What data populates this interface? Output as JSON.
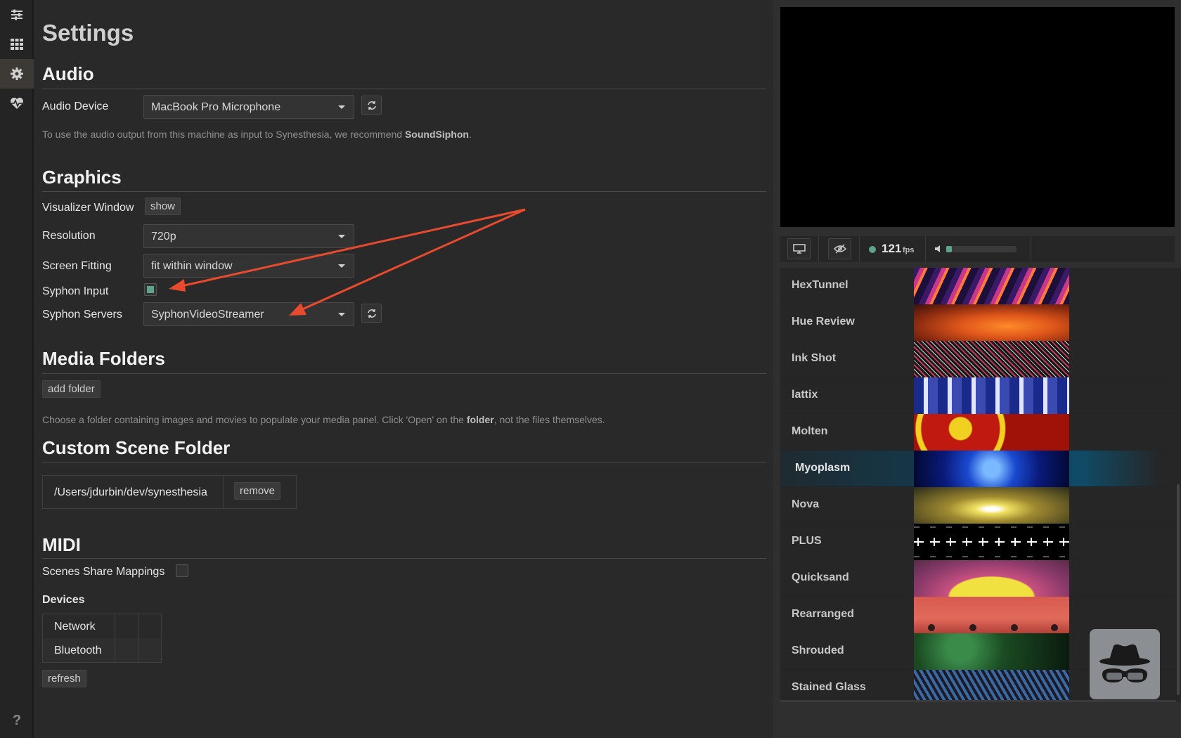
{
  "rail": {
    "items": [
      {
        "icon": "sliders-icon",
        "active": false
      },
      {
        "icon": "grid-icon",
        "active": false
      },
      {
        "icon": "gear-icon",
        "active": true
      },
      {
        "icon": "heart-pulse-icon",
        "active": false
      }
    ],
    "help_label": "?"
  },
  "settings": {
    "title": "Settings",
    "audio": {
      "title": "Audio",
      "device_label": "Audio Device",
      "device_value": "MacBook Pro Microphone",
      "help_prefix": "To use the audio output from this machine as input to Synesthesia, we recommend ",
      "help_bold": "SoundSiphon",
      "help_suffix": "."
    },
    "graphics": {
      "title": "Graphics",
      "visualizer_label": "Visualizer Window",
      "visualizer_button": "show",
      "resolution_label": "Resolution",
      "resolution_value": "720p",
      "fitting_label": "Screen Fitting",
      "fitting_value": "fit within window",
      "syphon_input_label": "Syphon Input",
      "syphon_input_checked": true,
      "syphon_servers_label": "Syphon Servers",
      "syphon_servers_value": "SyphonVideoStreamer"
    },
    "media": {
      "title": "Media Folders",
      "add_button": "add folder",
      "help_prefix": "Choose a folder containing images and movies to populate your media panel. Click 'Open' on the ",
      "help_bold": "folder",
      "help_suffix": ", not the files themselves."
    },
    "custom_scene": {
      "title": "Custom Scene Folder",
      "path": "/Users/jdurbin/dev/synesthesia",
      "remove_button": "remove"
    },
    "midi": {
      "title": "MIDI",
      "share_label": "Scenes Share Mappings",
      "share_checked": false,
      "devices_label": "Devices",
      "devices": [
        "Network",
        "Bluetooth"
      ],
      "refresh_button": "refresh"
    }
  },
  "preview_controls": {
    "fps_value": "121",
    "fps_unit": "fps",
    "volume_fraction": 0.08,
    "accent_color": "#5fa38b"
  },
  "scenes": [
    {
      "name": "HexTunnel",
      "active": false
    },
    {
      "name": "Hue Review",
      "active": false
    },
    {
      "name": "Ink Shot",
      "active": false
    },
    {
      "name": "lattix",
      "active": false
    },
    {
      "name": "Molten",
      "active": false
    },
    {
      "name": "Myoplasm",
      "active": true
    },
    {
      "name": "Nova",
      "active": false
    },
    {
      "name": "PLUS",
      "active": false
    },
    {
      "name": "Quicksand",
      "active": false
    },
    {
      "name": "Rearranged",
      "active": false
    },
    {
      "name": "Shrouded",
      "active": false
    },
    {
      "name": "Stained Glass",
      "active": false
    }
  ]
}
